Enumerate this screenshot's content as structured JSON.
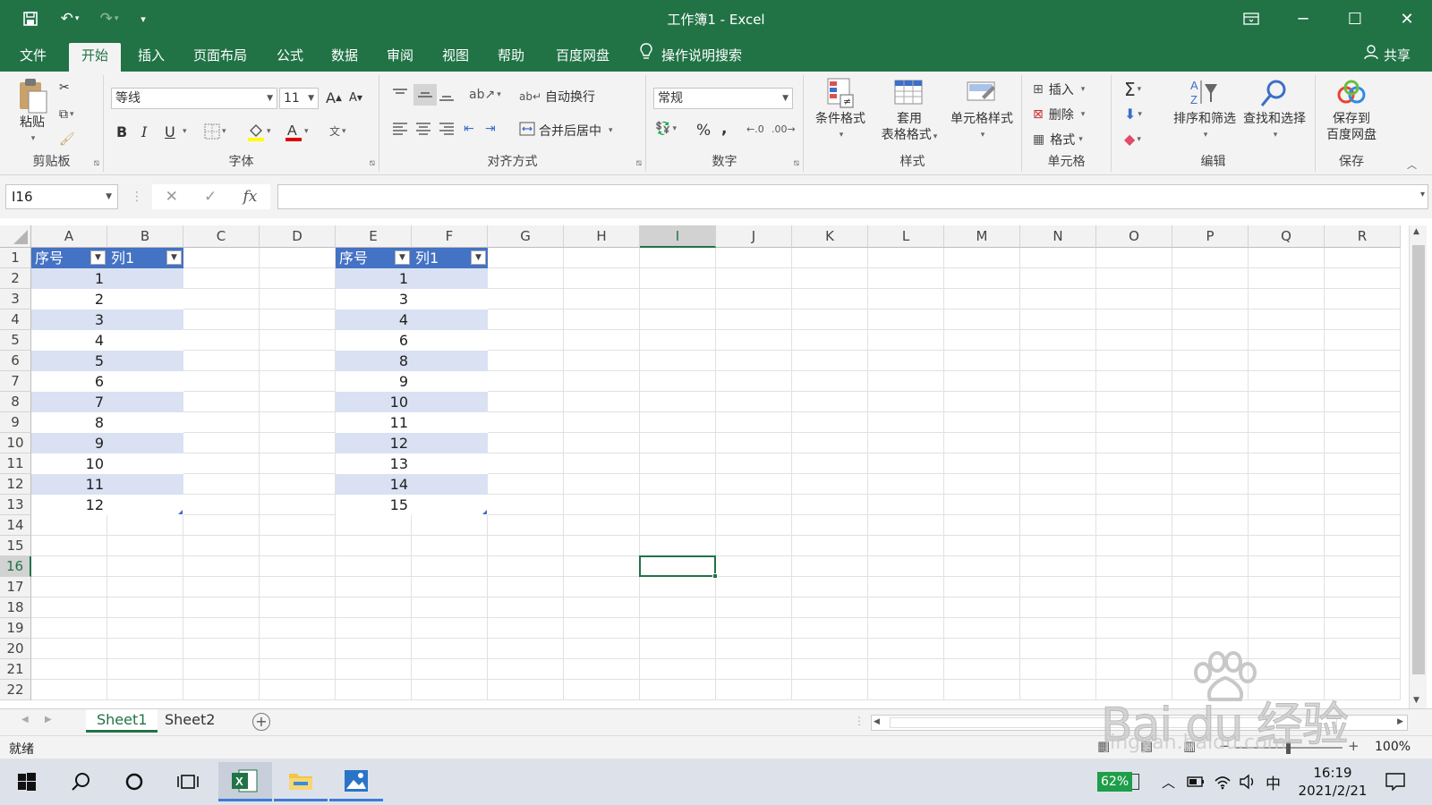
{
  "window": {
    "title": "工作簿1  -  Excel"
  },
  "menu": {
    "tabs": [
      "文件",
      "开始",
      "插入",
      "页面布局",
      "公式",
      "数据",
      "审阅",
      "视图",
      "帮助",
      "百度网盘"
    ],
    "tell_me": "操作说明搜索",
    "share": "共享"
  },
  "ribbon": {
    "clipboard": {
      "label": "剪贴板",
      "paste": "粘贴"
    },
    "font": {
      "label": "字体",
      "name": "等线",
      "size": "11",
      "bold": "B",
      "italic": "I",
      "underline": "U"
    },
    "alignment": {
      "label": "对齐方式",
      "wrap": "自动换行",
      "merge": "合并后居中"
    },
    "number": {
      "label": "数字",
      "format": "常规",
      "percent": "%",
      "comma": ","
    },
    "styles": {
      "label": "样式",
      "conditional": "条件格式",
      "table_format_1": "套用",
      "table_format_2": "表格格式",
      "cell_styles": "单元格样式"
    },
    "cells": {
      "label": "单元格",
      "insert": "插入",
      "delete": "删除",
      "format": "格式"
    },
    "editing": {
      "label": "编辑",
      "sort_filter": "排序和筛选",
      "find_select": "查找和选择"
    },
    "save": {
      "label": "保存",
      "save_1": "保存到",
      "save_2": "百度网盘"
    }
  },
  "formula_bar": {
    "name_box": "I16",
    "fx": "fx",
    "value": ""
  },
  "columns": [
    "A",
    "B",
    "C",
    "D",
    "E",
    "F",
    "G",
    "H",
    "I",
    "J",
    "K",
    "L",
    "M",
    "N",
    "O",
    "P",
    "Q",
    "R"
  ],
  "selected_column": "I",
  "rows": [
    "1",
    "2",
    "3",
    "4",
    "5",
    "6",
    "7",
    "8",
    "9",
    "10",
    "11",
    "12",
    "13",
    "14",
    "15",
    "16",
    "17",
    "18",
    "19",
    "20",
    "21",
    "22"
  ],
  "selected_row": "16",
  "table1": {
    "headers": [
      "序号",
      "列1"
    ],
    "values": [
      "1",
      "2",
      "3",
      "4",
      "5",
      "6",
      "7",
      "8",
      "9",
      "10",
      "11",
      "12"
    ]
  },
  "table2": {
    "headers": [
      "序号",
      "列1"
    ],
    "values": [
      "1",
      "3",
      "4",
      "6",
      "8",
      "9",
      "10",
      "11",
      "12",
      "13",
      "14",
      "15"
    ]
  },
  "sheets": [
    "Sheet1",
    "Sheet2"
  ],
  "active_sheet": "Sheet1",
  "status": {
    "ready": "就绪",
    "zoom": "100%"
  },
  "taskbar": {
    "battery": "62%",
    "ime": "中",
    "time": "16:19",
    "date": "2021/2/21"
  },
  "watermark": {
    "line1": "Bai du 经验",
    "line2": "jingyan.baidu.com"
  },
  "colors": {
    "excel_green": "#217346",
    "table_header": "#4472c4",
    "table_band": "#d9e1f2"
  }
}
